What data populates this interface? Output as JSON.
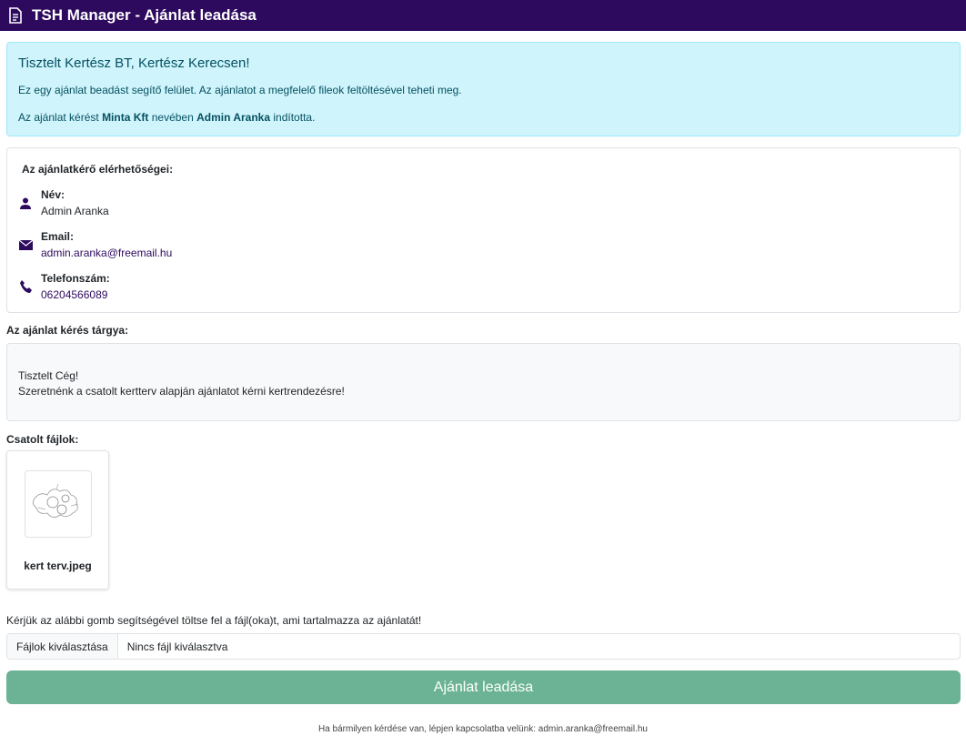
{
  "header": {
    "title": "TSH Manager - Ajánlat leadása",
    "icon": "document-icon",
    "background": "#2d0a5e"
  },
  "alert": {
    "greeting": "Tisztelt Kertész BT, Kertész Kerecsen!",
    "intro": "Ez egy ajánlat beadást segítő felület. Az ajánlatot a megfelelő fileok feltöltésével teheti meg.",
    "request_prefix": "Az ajánlat kérést",
    "company": "Minta Kft",
    "request_middle": "nevében",
    "requester": "Admin Aranka",
    "request_suffix": "indította."
  },
  "contact": {
    "title": "Az ajánlatkérő elérhetőségei:",
    "name_label": "Név:",
    "name_value": "Admin Aranka",
    "email_label": "Email:",
    "email_value": "admin.aranka@freemail.hu",
    "phone_label": "Telefonszám:",
    "phone_value": "06204566089"
  },
  "subject": {
    "label": "Az ajánlat kérés tárgya:",
    "line1": "Tisztelt Cég!",
    "line2": "Szeretnénk a csatolt kertterv alapján ajánlatot kérni kertrendezésre!"
  },
  "attachments": {
    "label": "Csatolt fájlok:",
    "files": [
      {
        "name": "kert terv.jpeg"
      }
    ]
  },
  "upload": {
    "instruction": "Kérjük az alábbi gomb segítségével töltse fel a fájl(oka)t, ami tartalmazza az ajánlatát!",
    "choose_label": "Fájlok kiválasztása",
    "none_selected": "Nincs fájl kiválasztva"
  },
  "submit": {
    "label": "Ajánlat leadása",
    "color": "#6bb394"
  },
  "footer": {
    "text": "Ha bármilyen kérdése van, lépjen kapcsolatba velünk: admin.aranka@freemail.hu"
  }
}
